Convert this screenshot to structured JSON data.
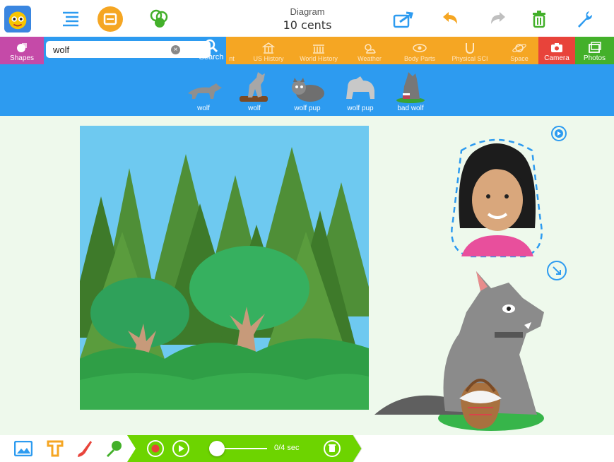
{
  "header": {
    "title": "Diagram",
    "subtitle": "10 cents",
    "icons": [
      "mascot-icon",
      "outline-icon",
      "card-icon",
      "layers-icon",
      "share-icon",
      "undo-icon",
      "redo-icon",
      "trash-icon",
      "wrench-icon"
    ]
  },
  "categories": {
    "shapes": "Shapes",
    "partial": "nt",
    "items": [
      "US History",
      "World History",
      "Weather",
      "Body Parts",
      "Physical SCI",
      "Space"
    ],
    "camera": "Camera",
    "photos": "Photos"
  },
  "search": {
    "value": "wolf",
    "button_label": "Search",
    "clear": "×"
  },
  "results": [
    {
      "label": "wolf"
    },
    {
      "label": "wolf"
    },
    {
      "label": "wolf pup"
    },
    {
      "label": "wolf pup"
    },
    {
      "label": "bad wolf"
    }
  ],
  "recorder": {
    "time": "0/4 sec",
    "slider_value": 0
  },
  "colors": {
    "accent_orange": "#f5a623",
    "blue": "#2d9bf0",
    "green": "#6dd400",
    "magenta": "#c54aa8"
  }
}
